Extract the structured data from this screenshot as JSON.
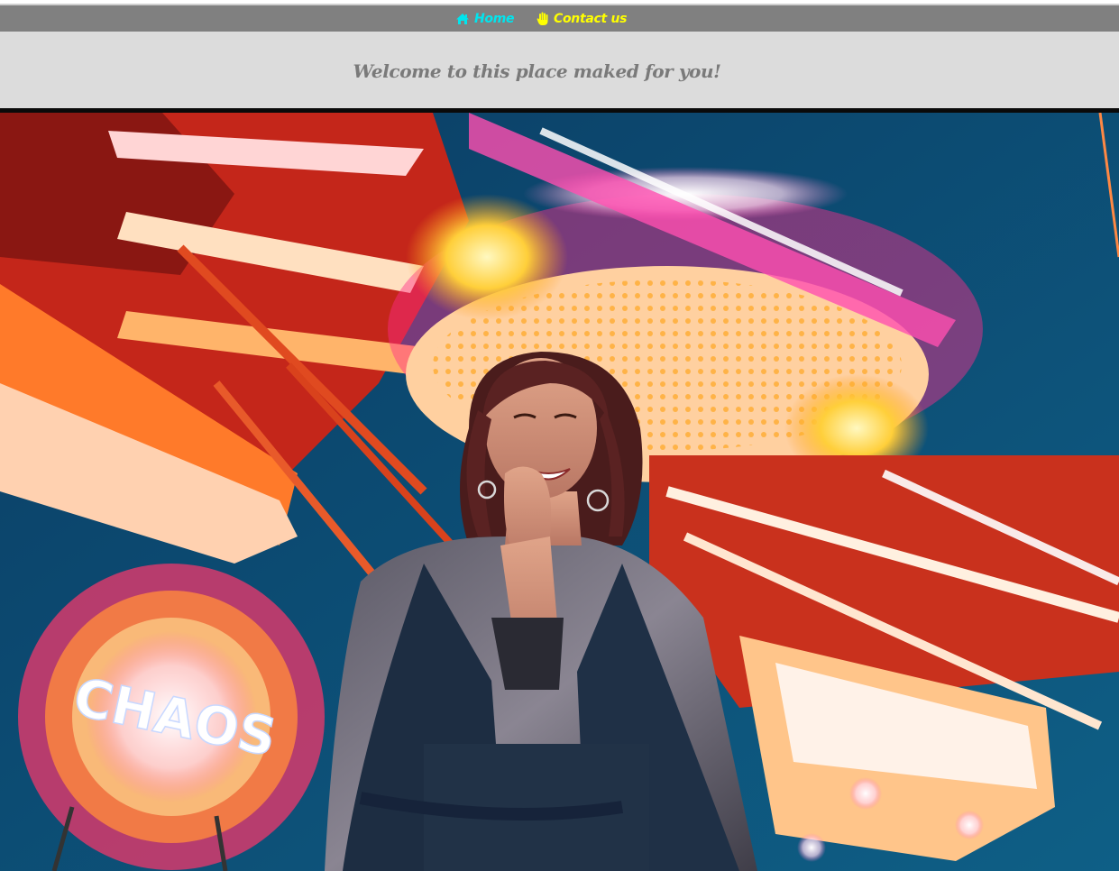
{
  "nav": {
    "items": [
      {
        "label": "Home",
        "icon": "home-icon",
        "color": "#00e5ee"
      },
      {
        "label": "Contact us",
        "icon": "hand-icon",
        "color": "#ffff00"
      }
    ],
    "background": "#808080"
  },
  "banner": {
    "title": "Welcome to this place maked for you!",
    "background": "#dcdcdc",
    "text_color": "#7a7a7a"
  },
  "hero": {
    "sign_text": "CHAOS"
  }
}
